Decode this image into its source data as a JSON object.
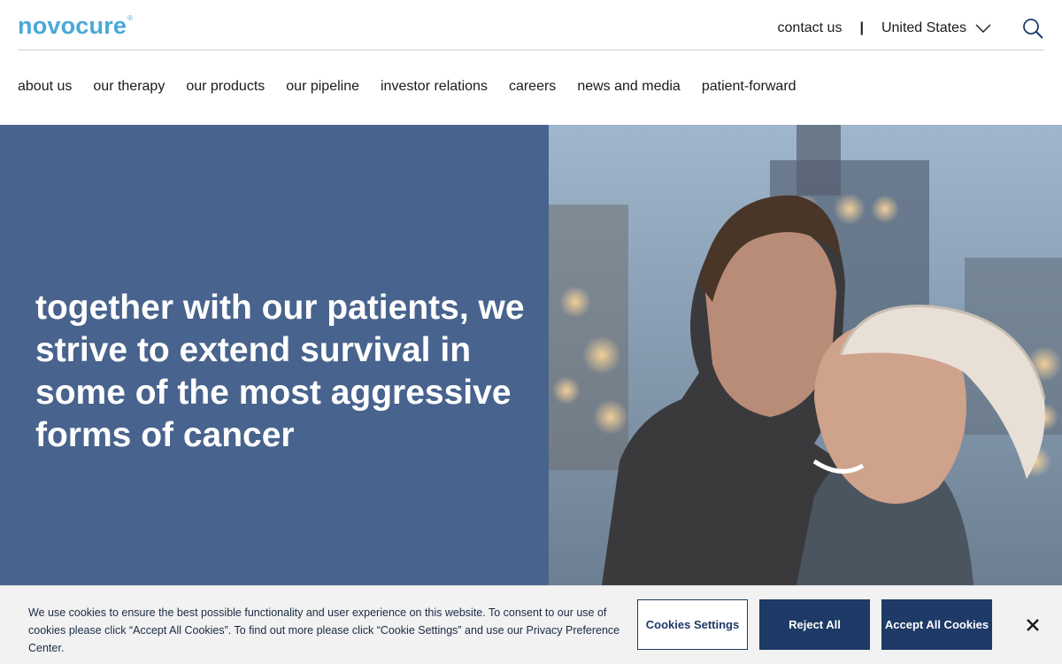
{
  "header": {
    "logo_text": "novocure",
    "logo_mark": "®",
    "contact_label": "contact us",
    "separator": "|",
    "country_label": "United States",
    "icons": {
      "country": "chevron-down-icon",
      "search": "search-icon"
    },
    "brand_color": "#4aa8d8"
  },
  "nav": {
    "items": [
      {
        "label": "about us"
      },
      {
        "label": "our therapy"
      },
      {
        "label": "our products"
      },
      {
        "label": "our pipeline"
      },
      {
        "label": "investor relations"
      },
      {
        "label": "careers"
      },
      {
        "label": "news and media"
      },
      {
        "label": "patient-forward"
      }
    ]
  },
  "hero": {
    "headline": "together with our patients, we strive to extend survival in some of the most aggressive forms of cancer",
    "panel_color": "#48638d"
  },
  "cookie": {
    "text": "We use cookies to ensure the best possible functionality and user experience on this website. To consent to our use of cookies please click “Accept All Cookies”. To find out more please click “Cookie Settings” and use our Privacy Preference Center.",
    "settings_label": "Cookies Settings",
    "reject_label": "Reject All",
    "accept_label": "Accept All Cookies",
    "close_icon": "close-icon",
    "button_color": "#1e3a66"
  }
}
